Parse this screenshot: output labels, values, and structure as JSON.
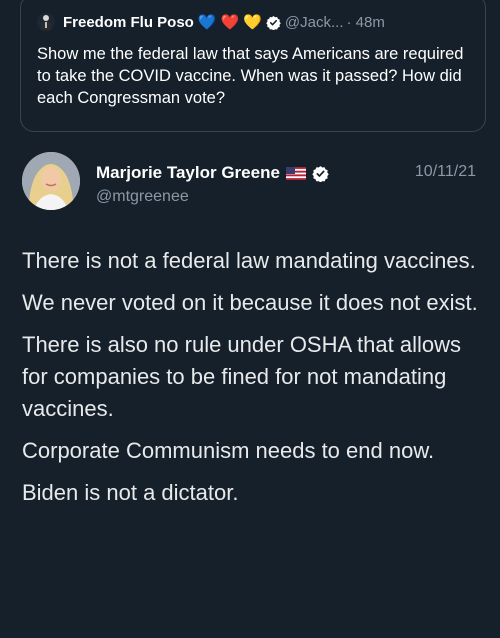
{
  "quoted_tweet": {
    "author_name": "Freedom Flu Poso",
    "emoji_hearts": [
      "💙",
      "❤️",
      "💛"
    ],
    "handle": "@Jack...",
    "time": "· 48m",
    "text": "Show me the federal law that says Americans are required to take the COVID vaccine. When was it passed? How did each Congressman vote?"
  },
  "tweet": {
    "author_name": "Marjorie Taylor Greene",
    "handle": "@mtgreenee",
    "date": "10/11/21",
    "paragraphs": [
      "There is not a federal law mandating vaccines.",
      "We never voted on it because it does not exist.",
      "There is also no rule under OSHA that allows for companies to be fined for not mandating vaccines.",
      "Corporate Communism needs to end now.",
      "Biden is not a dictator."
    ]
  },
  "colors": {
    "background": "#15202b",
    "border": "#38444d",
    "secondary_text": "#8b98a5",
    "verified_badge": "#ffffff"
  },
  "icons": {
    "quote_avatar": "person-avatar-icon",
    "verified": "verified-badge-icon",
    "flag": "us-flag-icon"
  }
}
